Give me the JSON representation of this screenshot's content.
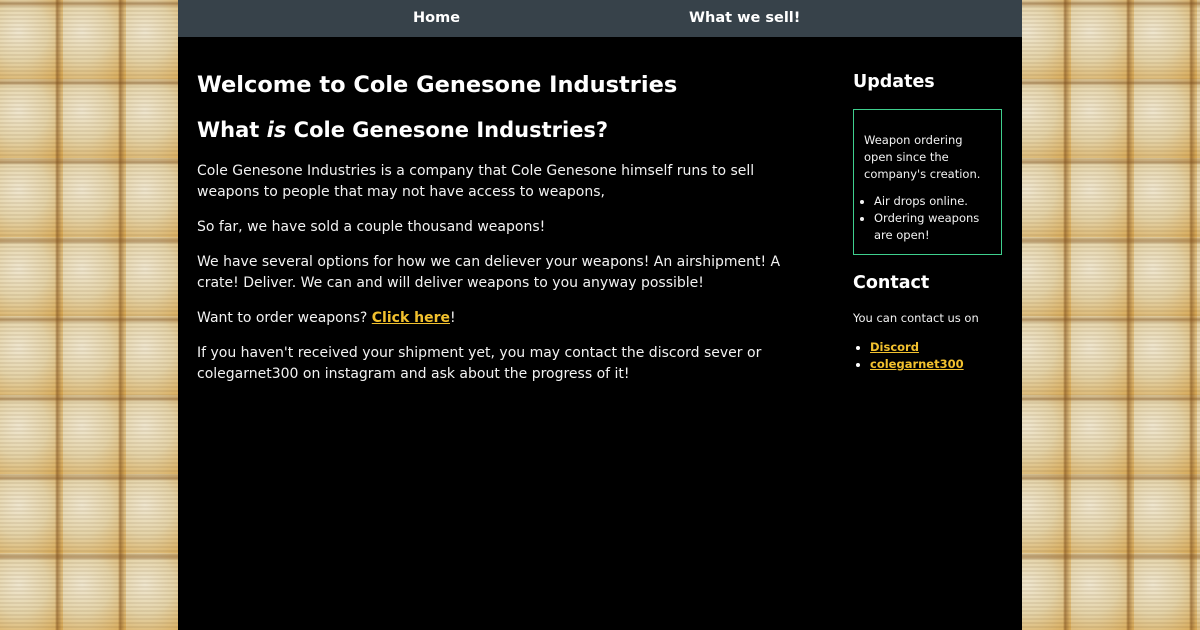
{
  "nav": {
    "home": "Home",
    "sell": "What we sell!"
  },
  "main": {
    "title": "Welcome to Cole Genesone Industries",
    "subtitle_pre": "What ",
    "subtitle_em": "is",
    "subtitle_post": " Cole Genesone Industries?",
    "p1": "Cole Genesone Industries is a company that Cole Genesone himself runs to sell weapons to people that may not have access to weapons,",
    "p2": "So far, we have sold a couple thousand weapons!",
    "p3": "We have several options for how we can deliever your weapons! An airshipment! A crate! Deliver. We can and will deliver weapons to you anyway possible!",
    "p4_pre": "Want to order weapons? ",
    "p4_link": "Click here",
    "p4_post": "!",
    "p5": "If you haven't received your shipment yet, you may contact the discord sever or colegarnet300 on instagram and ask about the progress of it!"
  },
  "sidebar": {
    "updates_title": "Updates",
    "updates_text": "Weapon ordering open since the company's creation.",
    "updates_items": [
      "Air drops online.",
      "Ordering weapons are open!"
    ],
    "contact_title": "Contact",
    "contact_text": "You can contact us on",
    "contact_links": [
      "Discord",
      "colegarnet300"
    ]
  },
  "colors": {
    "nav_bg": "#37424a",
    "page_bg": "#000000",
    "link": "#f2c12e",
    "updates_border": "#3fcf8e"
  }
}
